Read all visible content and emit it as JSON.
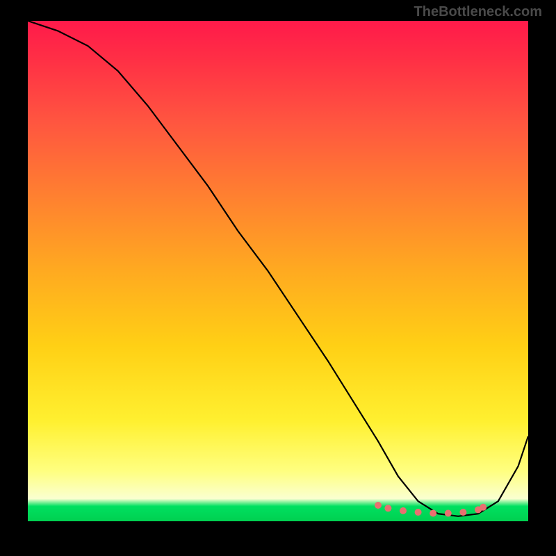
{
  "watermark": "TheBottleneck.com",
  "chart_data": {
    "type": "line",
    "title": "",
    "xlabel": "",
    "ylabel": "",
    "xlim": [
      0,
      100
    ],
    "ylim": [
      0,
      100
    ],
    "series": [
      {
        "name": "bottleneck-curve",
        "x": [
          0,
          6,
          12,
          18,
          24,
          30,
          36,
          42,
          48,
          54,
          60,
          65,
          70,
          74,
          78,
          82,
          86,
          90,
          94,
          98,
          100
        ],
        "y": [
          100,
          98,
          95,
          90,
          83,
          75,
          67,
          58,
          50,
          41,
          32,
          24,
          16,
          9,
          4,
          1.5,
          1,
          1.5,
          4,
          11,
          17
        ]
      }
    ],
    "markers": {
      "name": "optimal-range-dots",
      "x": [
        70,
        72,
        75,
        78,
        81,
        84,
        87,
        90,
        91
      ],
      "y": [
        3.2,
        2.6,
        2.1,
        1.8,
        1.6,
        1.6,
        1.8,
        2.3,
        2.8
      ],
      "color": "#e87070"
    }
  }
}
